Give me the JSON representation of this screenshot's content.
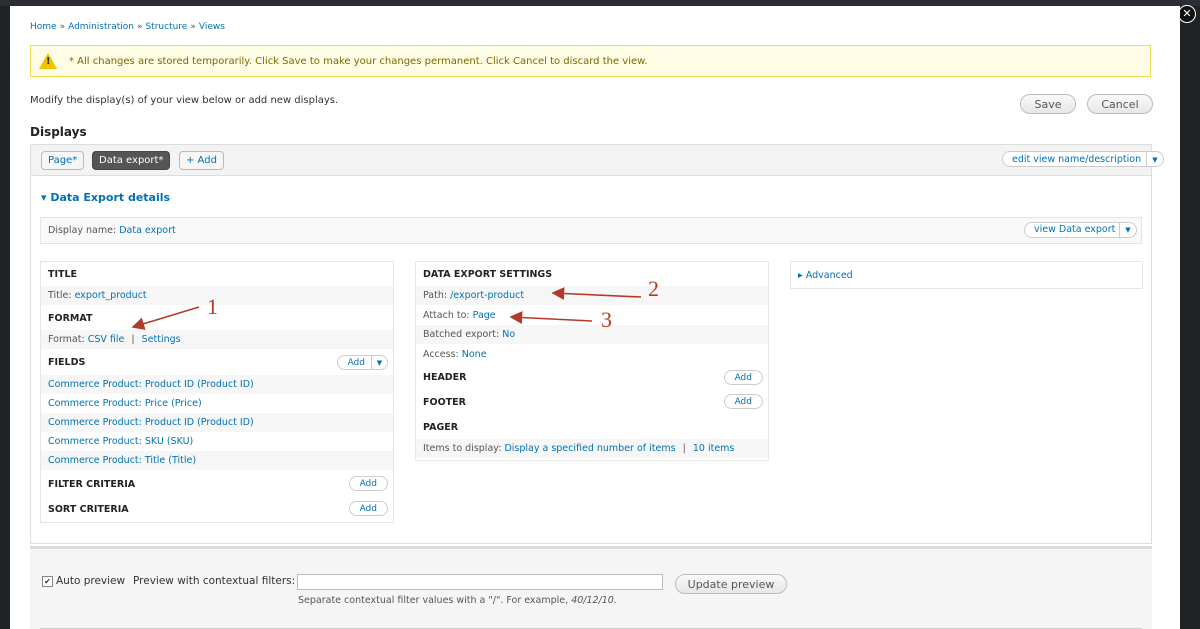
{
  "breadcrumb": [
    "Home",
    "Administration",
    "Structure",
    "Views"
  ],
  "breadcrumb_sep": "»",
  "warning": "* All changes are stored temporarily. Click Save to make your changes permanent. Click Cancel to discard the view.",
  "warning_icon": "!",
  "modify_text": "Modify the display(s) of your view below or add new displays.",
  "actions": {
    "save": "Save",
    "cancel": "Cancel"
  },
  "close_glyph": "✕",
  "displays_title": "Displays",
  "tabs": [
    {
      "label": "Page*"
    },
    {
      "label": "Data export*"
    },
    {
      "label": "+ Add"
    }
  ],
  "edit_name_dd": "edit view name/description",
  "details_toggle": "▾ Data Export details",
  "display_name": {
    "label": "Display name:",
    "value": "Data export"
  },
  "view_export_dd": "view Data export",
  "col1": {
    "title_head": "TITLE",
    "title_label": "Title:",
    "title_value": "export_product",
    "format_head": "FORMAT",
    "format_label": "Format:",
    "format_value": "CSV file",
    "format_sep": "|",
    "format_settings": "Settings",
    "fields_head": "FIELDS",
    "add": "Add",
    "fields": [
      "Commerce Product: Product ID (Product ID)",
      "Commerce Product: Price (Price)",
      "Commerce Product: Product ID (Product ID)",
      "Commerce Product: SKU (SKU)",
      "Commerce Product: Title (Title)"
    ],
    "filter_head": "FILTER CRITERIA",
    "sort_head": "SORT CRITERIA"
  },
  "col2": {
    "settings_head": "DATA EXPORT SETTINGS",
    "path_label": "Path:",
    "path_value": "/export-product",
    "attach_label": "Attach to:",
    "attach_value": "Page",
    "batched_label": "Batched export:",
    "batched_value": "No",
    "access_label": "Access:",
    "access_value": "None",
    "header_head": "HEADER",
    "footer_head": "FOOTER",
    "pager_head": "PAGER",
    "items_label": "Items to display:",
    "items_value1": "Display a specified number of items",
    "items_sep": "|",
    "items_value2": "10 items",
    "add": "Add"
  },
  "advanced": "▸ Advanced",
  "annotations": [
    "1",
    "2",
    "3"
  ],
  "preview": {
    "checkbox_mark": "✔",
    "auto_preview": "Auto preview",
    "contextual_label": "Preview with contextual filters:",
    "contextual_value": "",
    "update": "Update preview",
    "help_prefix": "Separate contextual filter values with a \"/\". For example, ",
    "help_example": "40/12/10."
  }
}
